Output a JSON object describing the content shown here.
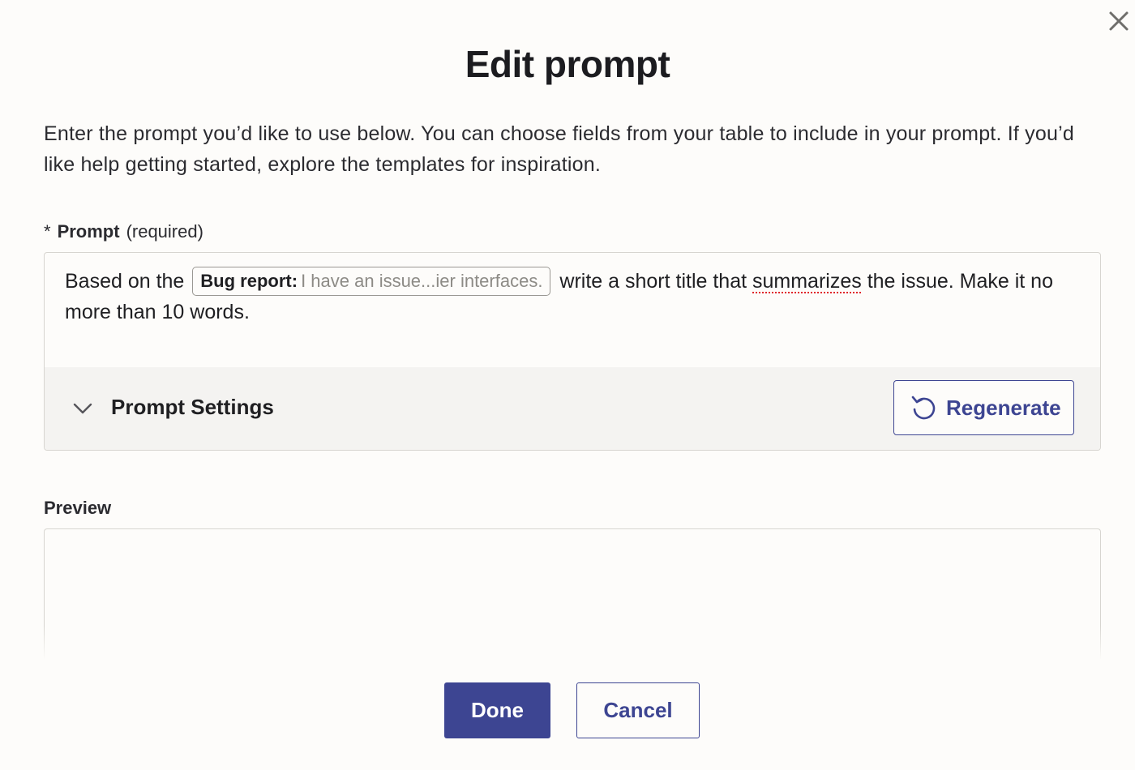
{
  "dialog": {
    "title": "Edit prompt",
    "close_icon": "close-icon",
    "description": "Enter the prompt you’d like to use below. You can choose fields from your table to include in your prompt. If you’d like help getting started, explore the templates for inspiration."
  },
  "prompt_field": {
    "required_marker": "*",
    "label": "Prompt",
    "hint": "(required)",
    "text_before": "Based on the",
    "chip": {
      "key": "Bug report:",
      "value": "I have an issue...ier interfaces."
    },
    "text_mid": "write a short title that",
    "misspelled_word": "summarizes",
    "text_after": "the issue. Make it no more than 10 words."
  },
  "settings": {
    "chevron_icon": "chevron-down-icon",
    "label": "Prompt Settings",
    "regenerate_icon": "refresh-icon",
    "regenerate_label": "Regenerate"
  },
  "preview": {
    "label": "Preview",
    "content": ""
  },
  "footer": {
    "done_label": "Done",
    "cancel_label": "Cancel"
  },
  "colors": {
    "accent": "#3d4592",
    "background": "#fdfcfa",
    "settings_bar": "#f4f3f1",
    "spellcheck": "#e0262b"
  }
}
